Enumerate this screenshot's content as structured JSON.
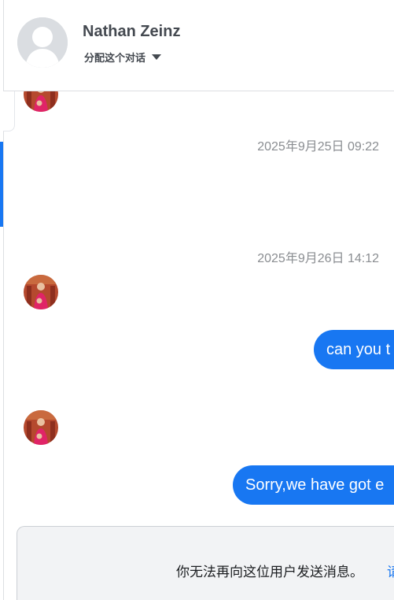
{
  "header": {
    "contact_name": "Nathan Zeinz",
    "assign_label": "分配这个对话",
    "assign_icon": "caret-down-icon",
    "avatar_icon": "default-user-avatar-icon"
  },
  "thread": {
    "timestamps": [
      "2025年9月25日 09:22",
      "2025年9月26日 14:12"
    ],
    "messages": [
      {
        "text": "can you t"
      },
      {
        "text": "Sorry,we have got e"
      }
    ],
    "bubble_color": "#1877f2"
  },
  "notice": {
    "text": "你无法再向这位用户发送消息。",
    "link": "请"
  },
  "colors": {
    "accent": "#1877f2",
    "notice_bg": "#f2f3f5",
    "timestamp": "#8a8d91"
  }
}
